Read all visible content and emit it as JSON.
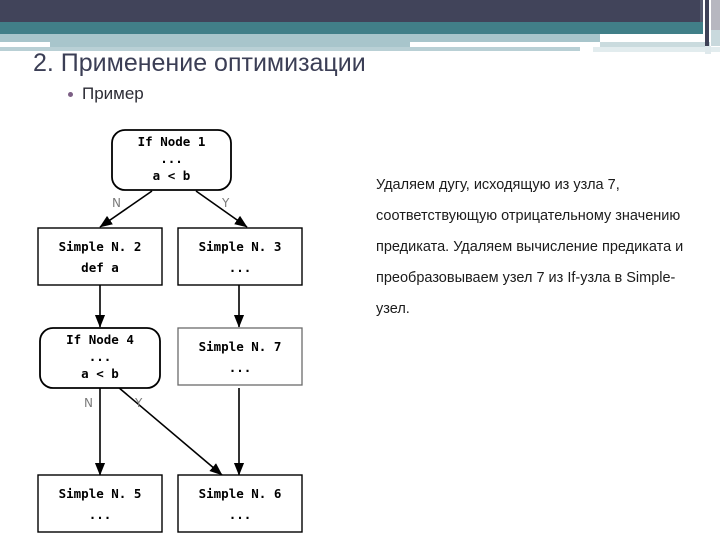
{
  "slide": {
    "title": "2. Применение оптимизации",
    "bullet": "Пример",
    "accent_dark": "#41445a",
    "accent_teal": "#417f88",
    "accent_pale": "#a8c5cb",
    "bullet_color": "#7c5f85"
  },
  "notes": {
    "paragraph": "Удаляем дугу, исходящую из узла 7, соответствующую отрицательному значению предиката. Удаляем вычисление предиката и преобразовываем узел 7 из If-узла в Simple-узел."
  },
  "diagram": {
    "type": "flowchart",
    "nodes": [
      {
        "id": "n1",
        "shape": "rounded",
        "lines": [
          "If Node 1",
          "...",
          "a < b"
        ]
      },
      {
        "id": "n2",
        "shape": "rect",
        "lines": [
          "Simple N. 2",
          "def a"
        ]
      },
      {
        "id": "n3",
        "shape": "rect",
        "lines": [
          "Simple N. 3",
          "..."
        ]
      },
      {
        "id": "n4",
        "shape": "rounded",
        "lines": [
          "If Node 4",
          "...",
          "a < b"
        ]
      },
      {
        "id": "n7",
        "shape": "rect",
        "lines": [
          "Simple N. 7",
          "..."
        ]
      },
      {
        "id": "n5",
        "shape": "rect",
        "lines": [
          "Simple N. 5",
          "..."
        ]
      },
      {
        "id": "n6",
        "shape": "rect",
        "lines": [
          "Simple N. 6",
          "..."
        ]
      }
    ],
    "edge_labels": {
      "n1_no": "N",
      "n1_yes": "Y",
      "n4_no": "N",
      "n4_yes": "Y"
    },
    "edges": [
      {
        "from": "n1",
        "to": "n2",
        "label": "N"
      },
      {
        "from": "n1",
        "to": "n3",
        "label": "Y"
      },
      {
        "from": "n2",
        "to": "n4",
        "label": ""
      },
      {
        "from": "n3",
        "to": "n7",
        "label": ""
      },
      {
        "from": "n4",
        "to": "n5",
        "label": "N"
      },
      {
        "from": "n4",
        "to": "n6",
        "label": "Y"
      },
      {
        "from": "n7",
        "to": "n6",
        "label": ""
      }
    ]
  }
}
